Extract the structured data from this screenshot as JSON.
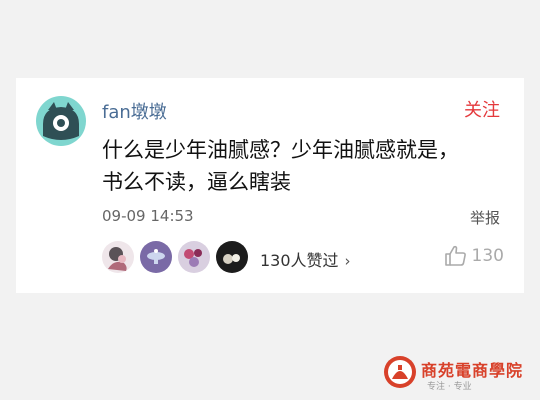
{
  "comment": {
    "username": "fan墩墩",
    "follow_label": "关注",
    "text": "什么是少年油腻感？少年油腻感就是，\n书么不读，逼么瞎装",
    "timestamp": "09-09 14:53",
    "report_label": "举报",
    "likes_text": "130人赞过",
    "likes_chevron": "›",
    "like_count": "130",
    "accent_color": "#e4393c",
    "username_color": "#4a6d95"
  },
  "watermark": {
    "title": "商苑電商學院",
    "subtitle": "专注 · 专业"
  }
}
